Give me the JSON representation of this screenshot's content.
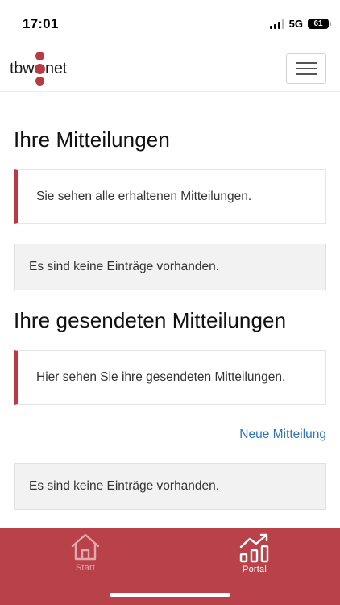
{
  "status_bar": {
    "time": "17:01",
    "network": "5G",
    "battery": "61"
  },
  "header": {
    "logo_left": "tbw",
    "logo_right": "net",
    "menu_icon": "hamburger-icon"
  },
  "received": {
    "title": "Ihre Mitteilungen",
    "info": "Sie sehen alle erhaltenen Mitteilungen.",
    "empty": "Es sind keine Einträge vorhanden."
  },
  "sent": {
    "title": "Ihre gesendeten Mitteilungen",
    "info": "Hier sehen Sie ihre gesendeten Mitteilungen.",
    "new_link": "Neue Mitteilung",
    "empty": "Es sind keine Einträge vorhanden."
  },
  "bottom_nav": {
    "items": [
      {
        "label": "Start",
        "icon": "home-icon",
        "active": false
      },
      {
        "label": "Portal",
        "icon": "chart-icon",
        "active": true
      }
    ]
  },
  "colors": {
    "brand_red": "#b9424a",
    "accent_border": "#b83b44",
    "link_blue": "#2f73b8"
  }
}
